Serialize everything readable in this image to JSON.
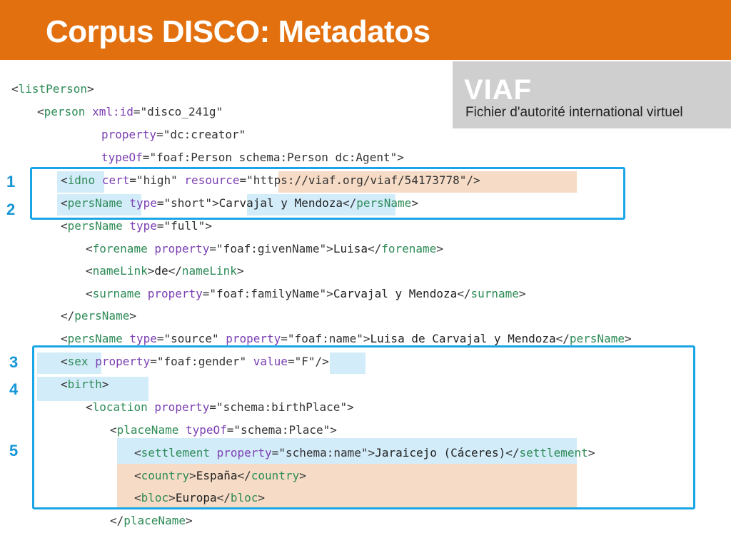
{
  "slide": {
    "title": "Corpus DISCO: Metadatos",
    "header_color": "#e3700f"
  },
  "viaf": {
    "logo": "VIAF",
    "subtitle": "Fichier d'autorité international virtuel"
  },
  "markers": [
    "1",
    "2",
    "3",
    "4",
    "5"
  ],
  "colors": {
    "frame": "#1aa6e6",
    "highlight_blue": "#d3ecfa",
    "highlight_orange": "#f6dcc6",
    "tag_name": "#2e8b57",
    "attribute": "#7b3fb2"
  },
  "code": [
    [
      [
        "p",
        "<"
      ],
      [
        "n",
        "listPerson"
      ],
      [
        "p",
        ">"
      ]
    ],
    [
      [
        "p",
        "<"
      ],
      [
        "n",
        "person"
      ],
      [
        "x",
        " "
      ],
      [
        "a",
        "xml:id"
      ],
      [
        "p",
        "="
      ],
      [
        "v",
        "\"disco_241g\""
      ]
    ],
    [
      [
        "a",
        "property"
      ],
      [
        "p",
        "="
      ],
      [
        "v",
        "\"dc:creator\""
      ]
    ],
    [
      [
        "a",
        "typeOf"
      ],
      [
        "p",
        "="
      ],
      [
        "v",
        "\"foaf:Person schema:Person dc:Agent\""
      ],
      [
        "p",
        ">"
      ]
    ],
    [
      [
        "p",
        "<"
      ],
      [
        "n",
        "idno"
      ],
      [
        "x",
        " "
      ],
      [
        "a",
        "cert"
      ],
      [
        "p",
        "="
      ],
      [
        "v",
        "\"high\""
      ],
      [
        "x",
        " "
      ],
      [
        "a",
        "resource"
      ],
      [
        "p",
        "="
      ],
      [
        "v",
        "\"https://viaf.org/viaf/54173778\""
      ],
      [
        "p",
        "/>"
      ]
    ],
    [
      [
        "p",
        "<"
      ],
      [
        "n",
        "persName"
      ],
      [
        "x",
        " "
      ],
      [
        "a",
        "type"
      ],
      [
        "p",
        "="
      ],
      [
        "v",
        "\"short\""
      ],
      [
        "p",
        ">"
      ],
      [
        "t",
        "Carvajal y Mendoza"
      ],
      [
        "p",
        "</"
      ],
      [
        "n",
        "persName"
      ],
      [
        "p",
        ">"
      ]
    ],
    [
      [
        "p",
        "<"
      ],
      [
        "n",
        "persName"
      ],
      [
        "x",
        " "
      ],
      [
        "a",
        "type"
      ],
      [
        "p",
        "="
      ],
      [
        "v",
        "\"full\""
      ],
      [
        "p",
        ">"
      ]
    ],
    [
      [
        "p",
        "<"
      ],
      [
        "n",
        "forename"
      ],
      [
        "x",
        " "
      ],
      [
        "a",
        "property"
      ],
      [
        "p",
        "="
      ],
      [
        "v",
        "\"foaf:givenName\""
      ],
      [
        "p",
        ">"
      ],
      [
        "t",
        "Luisa"
      ],
      [
        "p",
        "</"
      ],
      [
        "n",
        "forename"
      ],
      [
        "p",
        ">"
      ]
    ],
    [
      [
        "p",
        "<"
      ],
      [
        "n",
        "nameLink"
      ],
      [
        "p",
        ">"
      ],
      [
        "t",
        "de"
      ],
      [
        "p",
        "</"
      ],
      [
        "n",
        "nameLink"
      ],
      [
        "p",
        ">"
      ]
    ],
    [
      [
        "p",
        "<"
      ],
      [
        "n",
        "surname"
      ],
      [
        "x",
        " "
      ],
      [
        "a",
        "property"
      ],
      [
        "p",
        "="
      ],
      [
        "v",
        "\"foaf:familyName\""
      ],
      [
        "p",
        ">"
      ],
      [
        "t",
        "Carvajal y Mendoza"
      ],
      [
        "p",
        "</"
      ],
      [
        "n",
        "surname"
      ],
      [
        "p",
        ">"
      ]
    ],
    [
      [
        "p",
        "</"
      ],
      [
        "n",
        "persName"
      ],
      [
        "p",
        ">"
      ]
    ],
    [
      [
        "p",
        "<"
      ],
      [
        "n",
        "persName"
      ],
      [
        "x",
        " "
      ],
      [
        "a",
        "type"
      ],
      [
        "p",
        "="
      ],
      [
        "v",
        "\"source\""
      ],
      [
        "x",
        " "
      ],
      [
        "a",
        "property"
      ],
      [
        "p",
        "="
      ],
      [
        "v",
        "\"foaf:name\""
      ],
      [
        "p",
        ">"
      ],
      [
        "t",
        "Luisa de Carvajal y Mendoza"
      ],
      [
        "p",
        "</"
      ],
      [
        "n",
        "persName"
      ],
      [
        "p",
        ">"
      ]
    ],
    [
      [
        "p",
        "<"
      ],
      [
        "n",
        "sex"
      ],
      [
        "x",
        " "
      ],
      [
        "a",
        "property"
      ],
      [
        "p",
        "="
      ],
      [
        "v",
        "\"foaf:gender\""
      ],
      [
        "x",
        " "
      ],
      [
        "a",
        "value"
      ],
      [
        "p",
        "="
      ],
      [
        "v",
        "\"F\""
      ],
      [
        "p",
        "/>"
      ]
    ],
    [
      [
        "p",
        "<"
      ],
      [
        "n",
        "birth"
      ],
      [
        "p",
        ">"
      ]
    ],
    [
      [
        "p",
        "<"
      ],
      [
        "n",
        "location"
      ],
      [
        "x",
        " "
      ],
      [
        "a",
        "property"
      ],
      [
        "p",
        "="
      ],
      [
        "v",
        "\"schema:birthPlace\""
      ],
      [
        "p",
        ">"
      ]
    ],
    [
      [
        "p",
        "<"
      ],
      [
        "n",
        "placeName"
      ],
      [
        "x",
        " "
      ],
      [
        "a",
        "typeOf"
      ],
      [
        "p",
        "="
      ],
      [
        "v",
        "\"schema:Place\""
      ],
      [
        "p",
        ">"
      ]
    ],
    [
      [
        "p",
        "<"
      ],
      [
        "n",
        "settlement"
      ],
      [
        "x",
        " "
      ],
      [
        "a",
        "property"
      ],
      [
        "p",
        "="
      ],
      [
        "v",
        "\"schema:name\""
      ],
      [
        "p",
        ">"
      ],
      [
        "t",
        "Jaraicejo (Cáceres)"
      ],
      [
        "p",
        "</"
      ],
      [
        "n",
        "settlement"
      ],
      [
        "p",
        ">"
      ]
    ],
    [
      [
        "p",
        "<"
      ],
      [
        "n",
        "country"
      ],
      [
        "p",
        ">"
      ],
      [
        "t",
        "España"
      ],
      [
        "p",
        "</"
      ],
      [
        "n",
        "country"
      ],
      [
        "p",
        ">"
      ]
    ],
    [
      [
        "p",
        "<"
      ],
      [
        "n",
        "bloc"
      ],
      [
        "p",
        ">"
      ],
      [
        "t",
        "Europa"
      ],
      [
        "p",
        "</"
      ],
      [
        "n",
        "bloc"
      ],
      [
        "p",
        ">"
      ]
    ],
    [
      [
        "p",
        "</"
      ],
      [
        "n",
        "placeName"
      ],
      [
        "p",
        ">"
      ]
    ]
  ]
}
